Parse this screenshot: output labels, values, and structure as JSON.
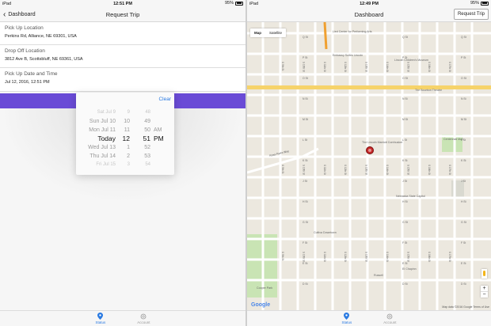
{
  "left": {
    "status": {
      "device": "iPad",
      "time": "12:51 PM",
      "battery": "95%"
    },
    "nav": {
      "back_label": "Dashboard",
      "title": "Request Trip"
    },
    "pickup": {
      "label": "Pick Up Location",
      "value": "Perkins Rd, Alliance, NE 69301, USA"
    },
    "dropoff": {
      "label": "Drop Off Location",
      "value": "3812 Ave B, Scottsbluff, NE 69361, USA"
    },
    "datetime": {
      "label": "Pick Up Date and Time",
      "value": "Jul 12, 2016, 12:51 PM"
    },
    "picker": {
      "clear_label": "Clear",
      "dates": [
        "Sat Jul 9",
        "Sun Jul 10",
        "Mon Jul 11",
        "Today",
        "Wed Jul 13",
        "Thu Jul 14",
        "Fri Jul 15"
      ],
      "hours": [
        "9",
        "10",
        "11",
        "12",
        "1",
        "2",
        "3"
      ],
      "minutes": [
        "48",
        "49",
        "50",
        "51",
        "52",
        "53",
        "54"
      ],
      "ampm": [
        "",
        "",
        "AM",
        "PM",
        "",
        "",
        ""
      ],
      "selected_index": 3
    },
    "tabs": [
      {
        "label": "Status",
        "icon": "location-pin-icon",
        "active": true
      },
      {
        "label": "Account",
        "icon": "gear-icon",
        "active": false
      }
    ]
  },
  "right": {
    "status": {
      "device": "iPad",
      "time": "12:49 PM",
      "battery": "95%"
    },
    "nav": {
      "title": "Dashboard",
      "right_button": "Request Trip"
    },
    "map": {
      "type_map": "Map",
      "type_satellite": "Satellite",
      "zoom_in": "+",
      "zoom_out": "−",
      "logo": "Google",
      "attribution": "Map data ©2016 Google  Terms of Use",
      "places": {
        "lied": "Lied Center for Performing Arts",
        "embassy": "Embassy Suites Lincoln",
        "childrens": "Lincoln Children's Museum",
        "bourbon": "The Bourbon Theatre",
        "marriott": "The Lincoln Marriott Cornhusker",
        "centennial": "Centennial Mall",
        "capitol": "Nebraska State Capitol",
        "cultiva": "Cultiva Downtown",
        "elchapin": "El Chapinn",
        "russell": "Russell",
        "cooper": "Cooper Park",
        "goodhue": "Goodhue Blvd",
        "rosaparks": "Rosa Parks Way",
        "centennial_mall": "Centennial Mall"
      },
      "streets_h": [
        "Q St",
        "P St",
        "O St",
        "N St",
        "M St",
        "L St",
        "K St",
        "J St",
        "H St",
        "G St",
        "F St",
        "E St",
        "D St"
      ],
      "streets_v": [
        "S 9th St",
        "S 10th St",
        "S 11th St",
        "S 12th St",
        "S 13th St",
        "S 14th St",
        "S 15th St",
        "S 16th St",
        "S 17th St"
      ]
    },
    "tabs": [
      {
        "label": "Status",
        "icon": "location-pin-icon",
        "active": true
      },
      {
        "label": "Account",
        "icon": "gear-icon",
        "active": false
      }
    ]
  }
}
